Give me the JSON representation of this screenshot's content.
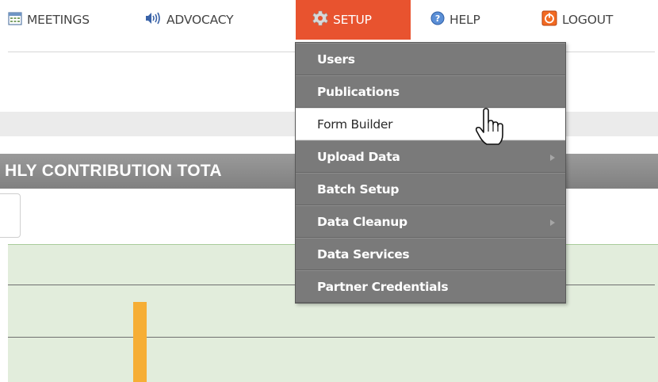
{
  "nav": {
    "items": [
      {
        "label": "MEETINGS",
        "icon": "calendar-icon"
      },
      {
        "label": "ADVOCACY",
        "icon": "speaker-icon"
      },
      {
        "label": "SETUP",
        "icon": "gear-icon"
      },
      {
        "label": "HELP",
        "icon": "help-icon"
      },
      {
        "label": "LOGOUT",
        "icon": "power-icon"
      }
    ],
    "active": "SETUP"
  },
  "section": {
    "title": "HLY CONTRIBUTION TOTA"
  },
  "setup_menu": {
    "items": [
      {
        "label": "Users"
      },
      {
        "label": "Publications"
      },
      {
        "label": "Form Builder",
        "hovered": true
      },
      {
        "label": "Upload Data",
        "has_submenu": true
      },
      {
        "label": "Batch Setup"
      },
      {
        "label": "Data Cleanup",
        "has_submenu": true
      },
      {
        "label": "Data Services"
      },
      {
        "label": "Partner Credentials"
      }
    ]
  },
  "colors": {
    "active_nav": "#e8532f",
    "menu_bg": "#7a7a7a",
    "chart_bg": "#e2eddc",
    "bar": "#f6ae35"
  }
}
